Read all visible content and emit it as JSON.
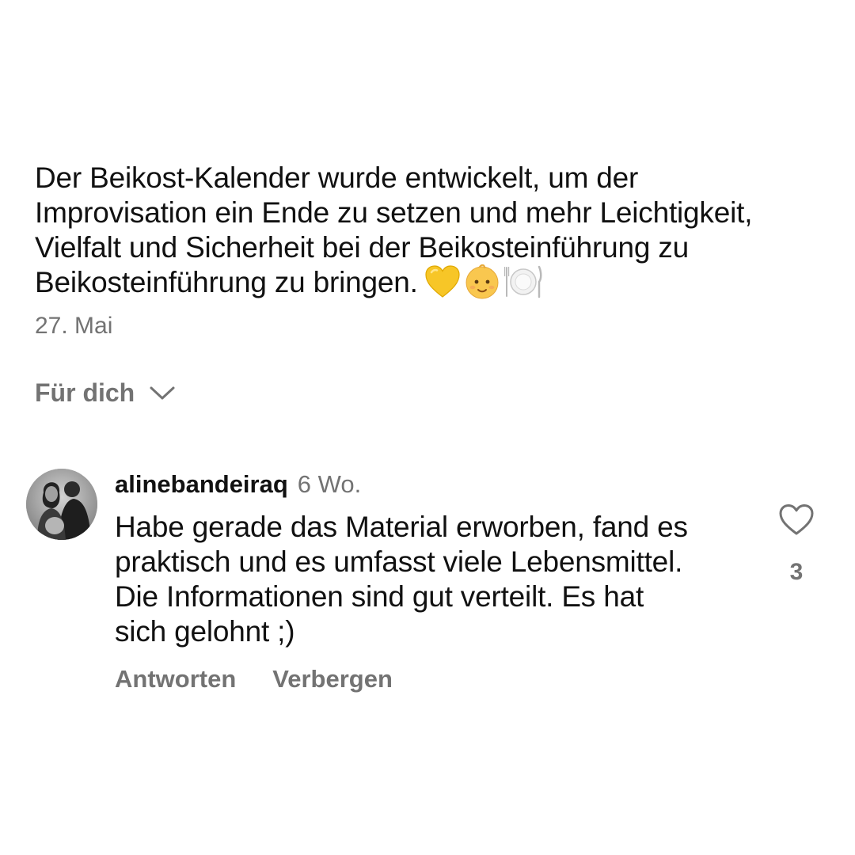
{
  "post": {
    "caption_lines": [
      "Der Beikost-Kalender wurde entwickelt, um der",
      "Improvisation ein Ende zu setzen und mehr Leichtigkeit,",
      "Vielfalt und Sicherheit bei der Beikosteinführung zu",
      "Beikosteinführung zu bringen."
    ],
    "caption_emojis": [
      "yellow-heart-icon",
      "baby-face-icon",
      "plate-cutlery-icon"
    ],
    "date": "27. Mai"
  },
  "comments_filter": {
    "label": "Für dich",
    "icon": "chevron-down-icon"
  },
  "comment": {
    "username": "alinebandeiraq",
    "time_ago": "6 Wo.",
    "text_lines": [
      "Habe gerade das Material erworben, fand es",
      "praktisch und es umfasst viele Lebensmittel.",
      "Die Informationen sind gut verteilt. Es hat",
      "sich gelohnt ;)"
    ],
    "actions": {
      "reply": "Antworten",
      "hide": "Verbergen"
    },
    "like_icon": "heart-outline-icon",
    "like_count": "3"
  },
  "colors": {
    "text_primary": "#111111",
    "text_secondary": "#737373",
    "background": "#ffffff",
    "emoji_heart": "#f7c627"
  }
}
